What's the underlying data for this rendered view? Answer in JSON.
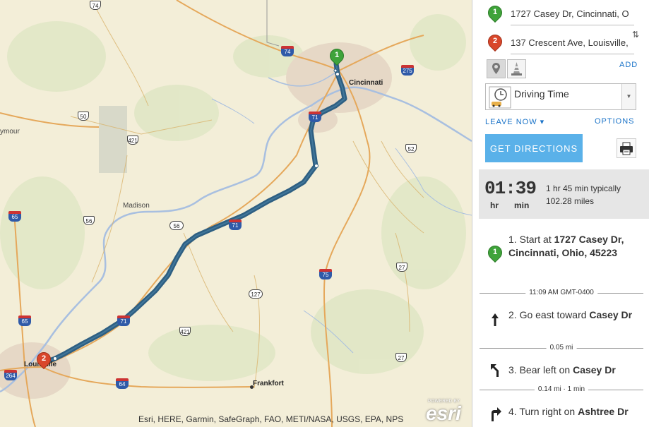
{
  "map": {
    "cities": {
      "cincinnati": "Cincinnati",
      "louisville": "Louisville",
      "frankfort": "Frankfort",
      "madison": "Madison",
      "seymour": "ymour"
    },
    "shields": {
      "i74_top": "74",
      "i74": "74",
      "i275": "275",
      "us50": "50",
      "us421_north": "421",
      "us52": "52",
      "i71_top": "71",
      "i65_west": "65",
      "i56": "56",
      "ky56": "56",
      "i71_mid": "71",
      "i75": "75",
      "ky27_a": "27",
      "ky127": "127",
      "i71_low": "71",
      "us421_south": "421",
      "i65_south": "65",
      "ky27_b": "27",
      "i264": "264",
      "i64": "64"
    },
    "markers": {
      "start": "1",
      "end": "2"
    },
    "attribution": "Esri, HERE, Garmin, SafeGraph, FAO, METI/NASA, USGS, EPA, NPS",
    "esri_powered": "POWERED BY",
    "esri_word": "esri",
    "route_color": "#2e5f82"
  },
  "panel": {
    "stops": [
      {
        "number": "1",
        "value": "1727 Casey Dr, Cincinnati, O",
        "color": "#3fa33a"
      },
      {
        "number": "2",
        "value": "137 Crescent Ave, Louisville,",
        "color": "#d9472b"
      }
    ],
    "swap_icon": "⇅",
    "add_label": "ADD",
    "travel_mode": "Driving Time",
    "leave_now": "LEAVE NOW ▾",
    "options": "OPTIONS",
    "get_directions": "GET DIRECTIONS",
    "summary": {
      "time": "01:39",
      "hr": "hr",
      "min": "min",
      "typical": "1 hr 45 min typically",
      "distance": "102.28 miles"
    },
    "steps": [
      {
        "num": "1.",
        "pre": "Start at ",
        "bold": "1727 Casey Dr, Cincinnati, Ohio, 45223",
        "post": ""
      },
      {
        "num": "2.",
        "pre": "Go east toward ",
        "bold": "Casey Dr",
        "post": ""
      },
      {
        "num": "3.",
        "pre": "Bear left on ",
        "bold": "Casey Dr",
        "post": ""
      },
      {
        "num": "4.",
        "pre": "Turn right on ",
        "bold": "Ashtree Dr",
        "post": ""
      }
    ],
    "separators": [
      "11:09 AM GMT-0400",
      "0.05 mi",
      "0.14 mi · 1 min"
    ]
  }
}
